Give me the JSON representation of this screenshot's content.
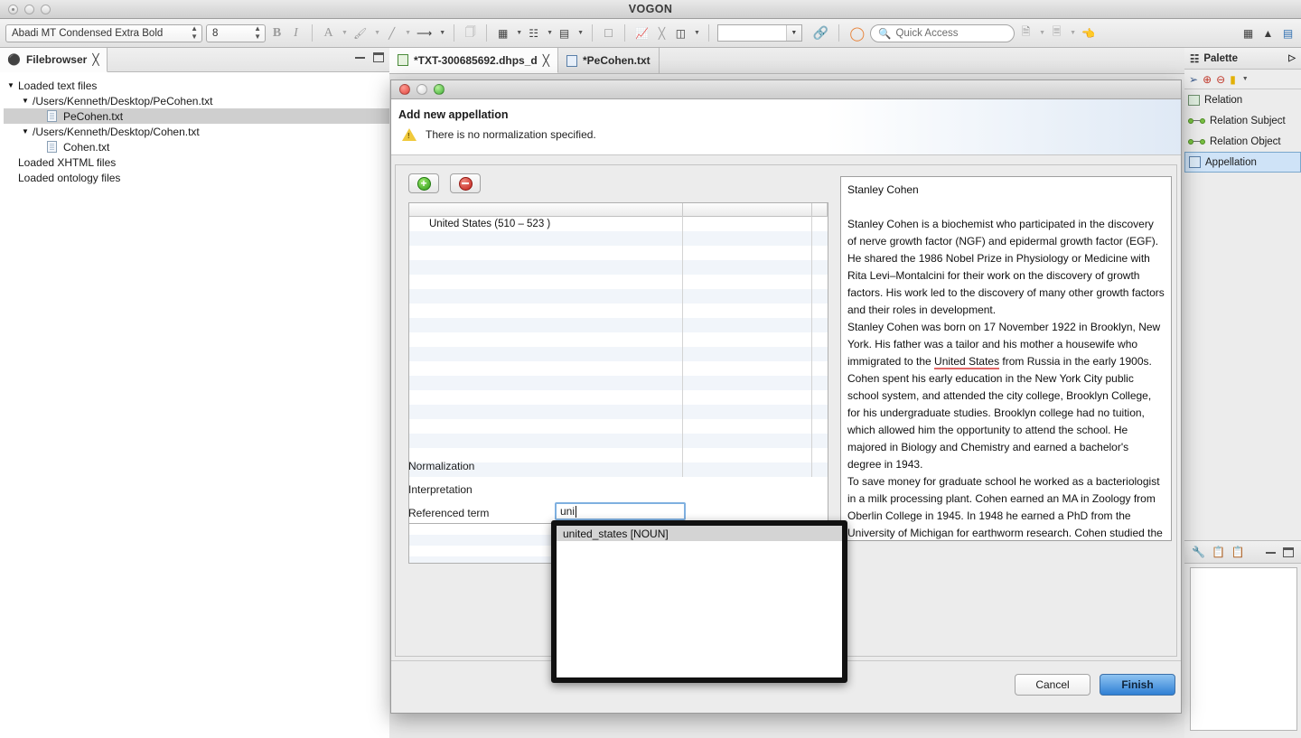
{
  "window": {
    "title": "VOGON"
  },
  "toolbar": {
    "font_name": "Abadi MT Condensed Extra Bold",
    "font_size": "8",
    "bold_label": "B",
    "italic_label": "I",
    "font_color_label": "A",
    "quick_access_placeholder": "Quick Access",
    "icons": {
      "fill_color": "paint-bucket-icon",
      "line_color": "pen-icon",
      "line_style": "arrow-icon",
      "copy": "copy-icon",
      "select_all": "select-all-icon",
      "align": "align-icon",
      "distribute": "distribute-icon",
      "crop": "crop-icon",
      "zoom_out_chart": "chart-icon",
      "cut_diagonal": "cut-icon",
      "split": "split-icon",
      "graph": "graph-icon",
      "progress": "progress-circle-icon",
      "new_wizard": "new-wizard-icon",
      "open_resource": "open-resource-icon",
      "pointer": "pointer-icon",
      "perspective_1": "perspective-network-icon",
      "perspective_2": "perspective-pyramid-icon",
      "perspective_3": "perspective-graph-icon"
    }
  },
  "filebrowser": {
    "view_title": "Filebrowser",
    "tree": [
      {
        "label": "Loaded text files",
        "depth": 0,
        "twisty": "▼",
        "type": "group",
        "selected": false
      },
      {
        "label": "/Users/Kenneth/Desktop/PeCohen.txt",
        "depth": 1,
        "twisty": "▼",
        "type": "group",
        "selected": false
      },
      {
        "label": "PeCohen.txt",
        "depth": 2,
        "twisty": "",
        "type": "file",
        "selected": true
      },
      {
        "label": "/Users/Kenneth/Desktop/Cohen.txt",
        "depth": 1,
        "twisty": "▼",
        "type": "group",
        "selected": false
      },
      {
        "label": "Cohen.txt",
        "depth": 2,
        "twisty": "",
        "type": "file",
        "selected": false
      },
      {
        "label": "Loaded XHTML files",
        "depth": 0,
        "twisty": "",
        "type": "group",
        "selected": false
      },
      {
        "label": "Loaded ontology files",
        "depth": 0,
        "twisty": "",
        "type": "group",
        "selected": false
      }
    ]
  },
  "editor": {
    "tabs": [
      {
        "label": "*TXT-300685692.dhps_d",
        "active": true,
        "closeable": true,
        "icon": "diagram-icon"
      },
      {
        "label": "*PeCohen.txt",
        "active": false,
        "closeable": false,
        "icon": "text-file-icon"
      }
    ]
  },
  "palette": {
    "title": "Palette",
    "tools": [
      "pointer-icon",
      "zoom-in-icon",
      "zoom-out-icon",
      "note-icon"
    ],
    "items": [
      {
        "label": "Relation",
        "icon": "relation-icon",
        "selected": false
      },
      {
        "label": "Relation Subject",
        "icon": "relation-subject-icon",
        "selected": false
      },
      {
        "label": "Relation Object",
        "icon": "relation-object-icon",
        "selected": false
      },
      {
        "label": "Appellation",
        "icon": "appellation-icon",
        "selected": true
      }
    ],
    "bottom_tools": [
      "wrench-icon",
      "edit-clipboard-icon",
      "add-clipboard-icon"
    ]
  },
  "dialog": {
    "title": "Add new appellation",
    "warning": "There is no normalization specified.",
    "warning_icon": "warning-triangle-icon",
    "add_button_icon": "add-circle-icon",
    "remove_button_icon": "remove-circle-icon",
    "table": {
      "columns": [
        "",
        "",
        ""
      ],
      "rows": [
        {
          "term": "United States (510 – 523 )"
        },
        {
          "term": ""
        },
        {
          "term": ""
        },
        {
          "term": ""
        },
        {
          "term": ""
        },
        {
          "term": ""
        },
        {
          "term": ""
        },
        {
          "term": ""
        },
        {
          "term": ""
        },
        {
          "term": ""
        },
        {
          "term": ""
        },
        {
          "term": ""
        },
        {
          "term": ""
        },
        {
          "term": ""
        },
        {
          "term": ""
        },
        {
          "term": ""
        },
        {
          "term": ""
        },
        {
          "term": ""
        }
      ]
    },
    "fields": {
      "normalization_label": "Normalization",
      "normalization_value": "uni",
      "interpretation_label": "Interpretation",
      "interpretation_value": "",
      "referenced_term_label": "Referenced term",
      "referenced_term_value": ""
    },
    "autocomplete": {
      "options": [
        "united_states [NOUN]"
      ],
      "selected_index": 0
    },
    "buttons": {
      "cancel": "Cancel",
      "finish": "Finish"
    }
  },
  "document": {
    "heading": "Stanley Cohen",
    "paragraphs": [
      "Stanley Cohen is a biochemist who participated in the discovery of nerve growth factor (NGF) and epidermal growth factor (EGF).  He shared the 1986 Nobel Prize in Physiology or Medicine with Rita Levi–Montalcini for their work on the discovery of growth factors.  His work led to the discovery of many other growth factors and their roles in development.",
      "Stanley Cohen was born on 17 November 1922 in Brooklyn, New York.  His father was a tailor and his mother a housewife who immigrated to the ",
      " from Russia in the early 1900s.  Cohen spent his early education in the New York City public school system, and attended the city college, Brooklyn College, for his undergraduate studies.  Brooklyn college had no tuition, which allowed him the opportunity to attend the school.   He majored in Biology and Chemistry and earned a bachelor's degree in 1943.",
      "To save money for graduate school he worked as a bacteriologist in a milk processing plant.  Cohen earned an MA in Zoology from Oberlin College in 1945.  In 1948 he earned a PhD from the University of Michigan for earthworm research.  Cohen studied the metabolic mechanism for the change in production from ammonia"
    ],
    "annotation_text": "United States",
    "annotation_color": "#e06666"
  }
}
